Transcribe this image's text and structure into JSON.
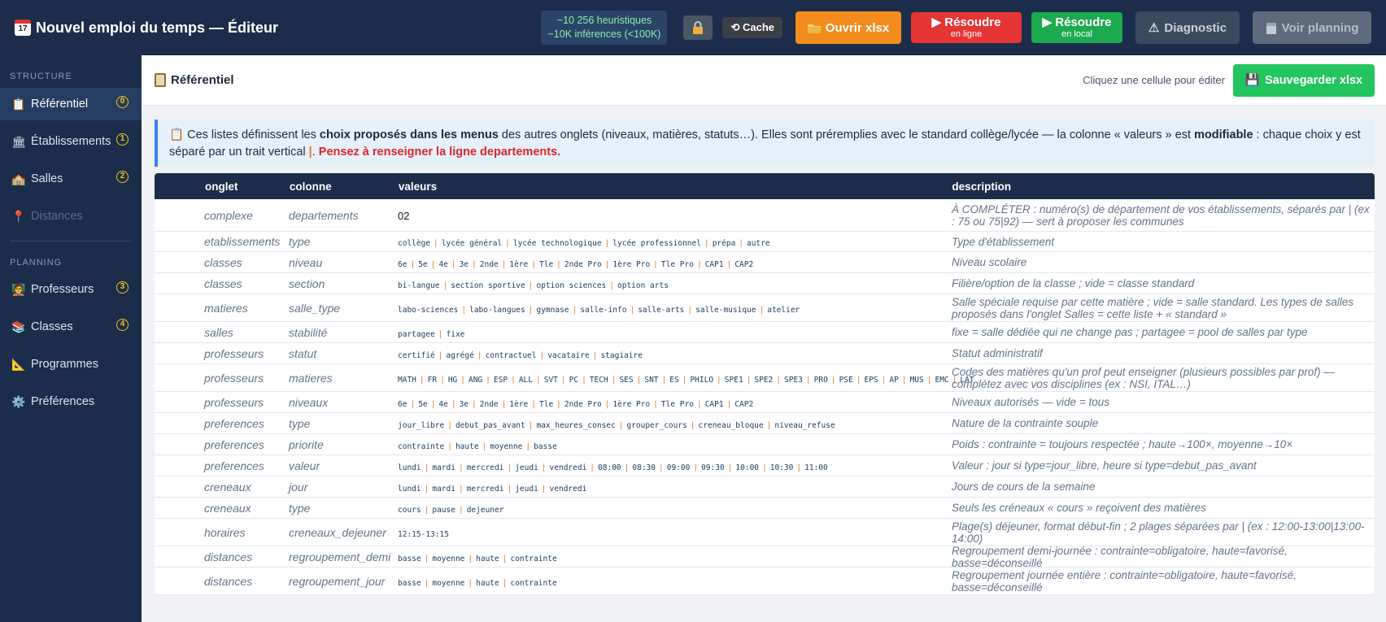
{
  "header": {
    "title": "Nouvel emploi du temps — Éditeur",
    "calendar_icon_day": "17",
    "stats_line1": "~10 256 heuristiques",
    "stats_line2": "~10K inférences (<100K)",
    "cache_label": "⟲ Cache",
    "open_label": "Ouvrir xlsx",
    "solve_online_label": "Résoudre",
    "solve_online_sub": "en ligne",
    "solve_local_label": "Résoudre",
    "solve_local_sub": "en local",
    "diagnostic_label": "Diagnostic",
    "planning_label": "Voir planning"
  },
  "sidebar": {
    "structure_heading": "STRUCTURE",
    "planning_heading": "PLANNING",
    "items": [
      {
        "label": "Référentiel",
        "num": "0"
      },
      {
        "label": "Établissements",
        "num": "1"
      },
      {
        "label": "Salles",
        "num": "2"
      },
      {
        "label": "Distances",
        "num": ""
      },
      {
        "label": "Professeurs",
        "num": "3"
      },
      {
        "label": "Classes",
        "num": "4"
      },
      {
        "label": "Programmes",
        "num": ""
      },
      {
        "label": "Préférences",
        "num": ""
      }
    ]
  },
  "main": {
    "section_title": "Référentiel",
    "hint": "Cliquez une cellule pour éditer",
    "save_label": "Sauvegarder xlsx",
    "info_part1": " Ces listes définissent les ",
    "info_bold1": "choix proposés dans les menus",
    "info_part2": " des autres onglets (niveaux, matières, statuts…). Elles sont préremplies avec le standard collège/lycée — la colonne « valeurs » est ",
    "info_bold2": "modifiable",
    "info_part3": " : chaque choix y est séparé par un trait vertical ",
    "info_pipe": "|",
    "info_part4": ". ",
    "info_warning": "Pensez à renseigner la ligne departements."
  },
  "table": {
    "headers": {
      "onglet": "onglet",
      "colonne": "colonne",
      "valeurs": "valeurs",
      "description": "description"
    },
    "rows": [
      {
        "onglet": "complexe",
        "colonne": "departements",
        "plain": "02",
        "valeurs": [],
        "description": "À COMPLÉTER : numéro(s) de département de vos établissements, séparés par | (ex : 75 ou 75|92) — sert à proposer les communes"
      },
      {
        "onglet": "etablissements",
        "colonne": "type",
        "valeurs": [
          "collège",
          "lycée général",
          "lycée technologique",
          "lycée professionnel",
          "prépa",
          "autre"
        ],
        "description": "Type d'établissement"
      },
      {
        "onglet": "classes",
        "colonne": "niveau",
        "valeurs": [
          "6e",
          "5e",
          "4e",
          "3e",
          "2nde",
          "1ère",
          "Tle",
          "2nde Pro",
          "1ère Pro",
          "Tle Pro",
          "CAP1",
          "CAP2"
        ],
        "description": "Niveau scolaire"
      },
      {
        "onglet": "classes",
        "colonne": "section",
        "valeurs": [
          "bi-langue",
          "section sportive",
          "option sciences",
          "option arts"
        ],
        "description": "Filière/option de la classe ; vide = classe standard"
      },
      {
        "onglet": "matieres",
        "colonne": "salle_type",
        "valeurs": [
          "labo-sciences",
          "labo-langues",
          "gymnase",
          "salle-info",
          "salle-arts",
          "salle-musique",
          "atelier"
        ],
        "description": "Salle spéciale requise par cette matière ; vide = salle standard. Les types de salles proposés dans l'onglet Salles = cette liste + « standard »"
      },
      {
        "onglet": "salles",
        "colonne": "stabilité",
        "valeurs": [
          "partagee",
          "fixe"
        ],
        "description": "fixe = salle dédiée qui ne change pas ; partagee = pool de salles par type"
      },
      {
        "onglet": "professeurs",
        "colonne": "statut",
        "valeurs": [
          "certifié",
          "agrégé",
          "contractuel",
          "vacataire",
          "stagiaire"
        ],
        "description": "Statut administratif"
      },
      {
        "onglet": "professeurs",
        "colonne": "matieres",
        "valeurs": [
          "MATH",
          "FR",
          "HG",
          "ANG",
          "ESP",
          "ALL",
          "SVT",
          "PC",
          "TECH",
          "SES",
          "SNT",
          "ES",
          "PHILO",
          "SPE1",
          "SPE2",
          "SPE3",
          "PRO",
          "PSE",
          "EPS",
          "AP",
          "MUS",
          "EMC",
          "LAT"
        ],
        "description": "Codes des matières qu'un prof peut enseigner (plusieurs possibles par prof) — complétez avec vos disciplines (ex : NSI, ITAL…)"
      },
      {
        "onglet": "professeurs",
        "colonne": "niveaux",
        "valeurs": [
          "6e",
          "5e",
          "4e",
          "3e",
          "2nde",
          "1ère",
          "Tle",
          "2nde Pro",
          "1ère Pro",
          "Tle Pro",
          "CAP1",
          "CAP2"
        ],
        "description": "Niveaux autorisés — vide = tous"
      },
      {
        "onglet": "preferences",
        "colonne": "type",
        "valeurs": [
          "jour_libre",
          "debut_pas_avant",
          "max_heures_consec",
          "grouper_cours",
          "creneau_bloque",
          "niveau_refuse"
        ],
        "description": "Nature de la contrainte souple"
      },
      {
        "onglet": "preferences",
        "colonne": "priorite",
        "valeurs": [
          "contrainte",
          "haute",
          "moyenne",
          "basse"
        ],
        "description": "Poids : contrainte = toujours respectée ; haute→100×, moyenne→10×"
      },
      {
        "onglet": "preferences",
        "colonne": "valeur",
        "valeurs": [
          "lundi",
          "mardi",
          "mercredi",
          "jeudi",
          "vendredi",
          "08:00",
          "08:30",
          "09:00",
          "09:30",
          "10:00",
          "10:30",
          "11:00"
        ],
        "description": "Valeur : jour si type=jour_libre, heure si type=debut_pas_avant"
      },
      {
        "onglet": "creneaux",
        "colonne": "jour",
        "valeurs": [
          "lundi",
          "mardi",
          "mercredi",
          "jeudi",
          "vendredi"
        ],
        "description": "Jours de cours de la semaine"
      },
      {
        "onglet": "creneaux",
        "colonne": "type",
        "valeurs": [
          "cours",
          "pause",
          "dejeuner"
        ],
        "description": "Seuls les créneaux « cours » reçoivent des matières"
      },
      {
        "onglet": "horaires",
        "colonne": "creneaux_dejeuner",
        "valeurs": [
          "12:15-13:15"
        ],
        "description": "Plage(s) déjeuner, format début-fin ; 2 plages séparées par | (ex : 12:00-13:00|13:00-14:00)"
      },
      {
        "onglet": "distances",
        "colonne": "regroupement_demi",
        "valeurs": [
          "basse",
          "moyenne",
          "haute",
          "contrainte"
        ],
        "description": "Regroupement demi-journée : contrainte=obligatoire, haute=favorisé, basse=déconseillé"
      },
      {
        "onglet": "distances",
        "colonne": "regroupement_jour",
        "valeurs": [
          "basse",
          "moyenne",
          "haute",
          "contrainte"
        ],
        "description": "Regroupement journée entière : contrainte=obligatoire, haute=favorisé, basse=déconseillé"
      }
    ]
  },
  "colors": {
    "navy": "#1b2d4a",
    "orange": "#f28c1c",
    "red": "#e53535",
    "green": "#1eaa4f",
    "save_green": "#22c55e",
    "badge_yellow": "#f5c518"
  }
}
